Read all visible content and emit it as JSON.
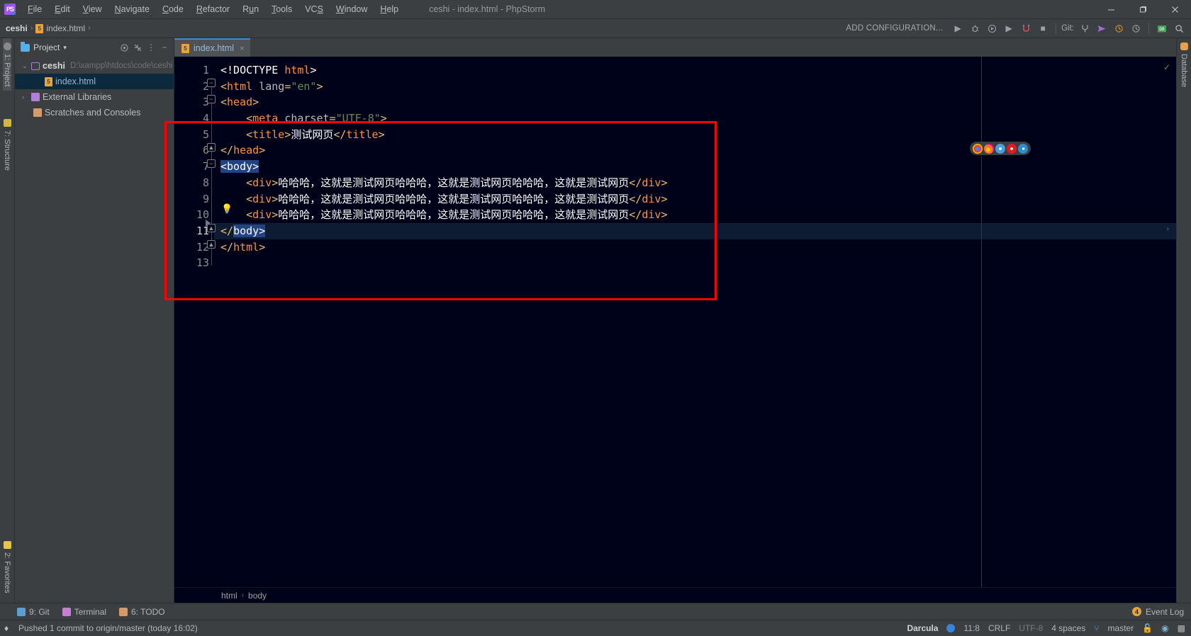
{
  "window": {
    "title": "ceshi - index.html - PhpStorm",
    "logo_icon": "phpstorm-logo-icon",
    "minimize_icon": "minimize-icon",
    "maximize_icon": "maximize-icon",
    "close_icon": "close-icon"
  },
  "menubar": [
    {
      "label": "File",
      "mnemonic": "F"
    },
    {
      "label": "Edit",
      "mnemonic": "E"
    },
    {
      "label": "View",
      "mnemonic": "V"
    },
    {
      "label": "Navigate",
      "mnemonic": "N"
    },
    {
      "label": "Code",
      "mnemonic": "C"
    },
    {
      "label": "Refactor",
      "mnemonic": "R"
    },
    {
      "label": "Run",
      "mnemonic": "u"
    },
    {
      "label": "Tools",
      "mnemonic": "T"
    },
    {
      "label": "VCS",
      "mnemonic": "S"
    },
    {
      "label": "Window",
      "mnemonic": "W"
    },
    {
      "label": "Help",
      "mnemonic": "H"
    }
  ],
  "navbar": {
    "crumbs": [
      {
        "label": "ceshi",
        "icon": ""
      },
      {
        "label": "index.html",
        "icon": "html5-file-icon"
      }
    ],
    "separator": "›",
    "add_configuration": "ADD CONFIGURATION...",
    "git_label": "Git:",
    "actions": [
      {
        "name": "run-button",
        "glyph": "▶"
      },
      {
        "name": "debug-button",
        "glyph": "☸"
      },
      {
        "name": "run-with-coverage-button",
        "glyph": "◉"
      },
      {
        "name": "run-profiler-button",
        "glyph": "▶"
      },
      {
        "name": "stop-debug-button",
        "glyph": "↓"
      },
      {
        "name": "stop-button",
        "glyph": "■"
      }
    ],
    "git_actions": [
      {
        "name": "update-project-icon",
        "glyph": "⑂"
      },
      {
        "name": "commit-icon",
        "glyph": "➤"
      },
      {
        "name": "rollback-icon",
        "glyph": "↺"
      },
      {
        "name": "history-icon",
        "glyph": "↻"
      }
    ],
    "right_actions": [
      {
        "name": "database-icon",
        "glyph": "▤"
      },
      {
        "name": "search-everywhere-icon",
        "glyph": "⚲"
      }
    ]
  },
  "left_strip": {
    "top": [
      {
        "label": "1: Project",
        "active": true,
        "icon_color": "#9a9a9a"
      },
      {
        "label": "7: Structure",
        "active": false,
        "icon_color": "#d6b63c"
      }
    ],
    "bottom": [
      {
        "label": "2: Favorites",
        "active": false,
        "icon_color": "#e8c547"
      }
    ]
  },
  "right_strip": {
    "items": [
      {
        "label": "Database",
        "icon_color": "#e8a33d"
      }
    ]
  },
  "project_panel": {
    "title": "Project",
    "title_dropdown": "▾",
    "actions": [
      {
        "name": "locate-file-icon",
        "glyph": "◎"
      },
      {
        "name": "collapse-all-icon",
        "glyph": "↖"
      },
      {
        "name": "options-icon",
        "glyph": "⋮"
      },
      {
        "name": "hide-icon",
        "glyph": "−"
      }
    ],
    "tree": [
      {
        "label": "ceshi",
        "path": "D:\\xampp\\htdocs\\code\\ceshi",
        "arrow": "⌄",
        "icon": "project-folder-icon",
        "indent": 0,
        "selected": false
      },
      {
        "label": "index.html",
        "path": "",
        "arrow": "",
        "icon": "html5-file-icon",
        "indent": 1,
        "selected": true
      },
      {
        "label": "External Libraries",
        "path": "",
        "arrow": "›",
        "icon": "library-icon",
        "indent": 0,
        "selected": false
      },
      {
        "label": "Scratches and Consoles",
        "path": "",
        "arrow": "",
        "icon": "scratches-icon",
        "indent": 0,
        "selected": false
      }
    ]
  },
  "editor": {
    "tab": {
      "label": "index.html",
      "icon": "html5-file-icon",
      "close": "×"
    },
    "line_numbers": [
      "1",
      "2",
      "3",
      "4",
      "5",
      "6",
      "7",
      "8",
      "9",
      "10",
      "11",
      "12",
      "13"
    ],
    "current_line": 11,
    "breadcrumbs": [
      "html",
      "body"
    ],
    "breadcrumb_sep": "›",
    "lines": [
      {
        "n": 1,
        "segments": [
          {
            "t": "<!DOCTYPE ",
            "c": "doctype"
          },
          {
            "t": "html",
            "c": "tagn"
          },
          {
            "t": ">",
            "c": "doctype"
          }
        ]
      },
      {
        "n": 2,
        "segments": [
          {
            "t": "<",
            "c": "tag"
          },
          {
            "t": "html",
            "c": "tagn"
          },
          {
            "t": " ",
            "c": "attr"
          },
          {
            "t": "lang",
            "c": "attr"
          },
          {
            "t": "=",
            "c": "tag"
          },
          {
            "t": "\"en\"",
            "c": "attrv"
          },
          {
            "t": ">",
            "c": "tag"
          }
        ]
      },
      {
        "n": 3,
        "segments": [
          {
            "t": "<",
            "c": "tag"
          },
          {
            "t": "head",
            "c": "tagn"
          },
          {
            "t": ">",
            "c": "tag"
          }
        ]
      },
      {
        "n": 4,
        "segments": [
          {
            "t": "    <",
            "c": "tag"
          },
          {
            "t": "meta",
            "c": "tagn"
          },
          {
            "t": " ",
            "c": "attr"
          },
          {
            "t": "charset",
            "c": "attr"
          },
          {
            "t": "=",
            "c": "tag"
          },
          {
            "t": "\"UTF-8\"",
            "c": "attrv"
          },
          {
            "t": ">",
            "c": "tag"
          }
        ]
      },
      {
        "n": 5,
        "segments": [
          {
            "t": "    <",
            "c": "tag"
          },
          {
            "t": "title",
            "c": "tagn"
          },
          {
            "t": ">",
            "c": "tag"
          },
          {
            "t": "测试网页",
            "c": "txt"
          },
          {
            "t": "</",
            "c": "tag"
          },
          {
            "t": "title",
            "c": "tagn"
          },
          {
            "t": ">",
            "c": "tag"
          }
        ]
      },
      {
        "n": 6,
        "segments": [
          {
            "t": "</",
            "c": "tag"
          },
          {
            "t": "head",
            "c": "tagn"
          },
          {
            "t": ">",
            "c": "tag"
          }
        ]
      },
      {
        "n": 7,
        "segments": [
          {
            "t": "<",
            "c": "sel"
          },
          {
            "t": "body",
            "c": "sel"
          },
          {
            "t": ">",
            "c": "sel"
          }
        ]
      },
      {
        "n": 8,
        "segments": [
          {
            "t": "    <",
            "c": "tag"
          },
          {
            "t": "div",
            "c": "tagn"
          },
          {
            "t": ">",
            "c": "tag"
          },
          {
            "t": "哈哈哈，这就是测试网页哈哈哈，这就是测试网页哈哈哈，这就是测试网页",
            "c": "txt"
          },
          {
            "t": "</",
            "c": "tag"
          },
          {
            "t": "div",
            "c": "tagn"
          },
          {
            "t": ">",
            "c": "tag"
          }
        ]
      },
      {
        "n": 9,
        "segments": [
          {
            "t": "    <",
            "c": "tag"
          },
          {
            "t": "div",
            "c": "tagn"
          },
          {
            "t": ">",
            "c": "tag"
          },
          {
            "t": "哈哈哈，这就是测试网页哈哈哈，这就是测试网页哈哈哈，这就是测试网页",
            "c": "txt"
          },
          {
            "t": "</",
            "c": "tag"
          },
          {
            "t": "div",
            "c": "tagn"
          },
          {
            "t": ">",
            "c": "tag"
          }
        ]
      },
      {
        "n": 10,
        "segments": [
          {
            "t": "    <",
            "c": "tag"
          },
          {
            "t": "div",
            "c": "tagn"
          },
          {
            "t": ">",
            "c": "tag"
          },
          {
            "t": "哈哈哈，这就是测试网页哈哈哈，这就是测试网页哈哈哈，这就是测试网页",
            "c": "txt"
          },
          {
            "t": "</",
            "c": "tag"
          },
          {
            "t": "div",
            "c": "tagn"
          },
          {
            "t": ">",
            "c": "tag"
          }
        ]
      },
      {
        "n": 11,
        "segments": [
          {
            "t": "</",
            "c": "tag"
          },
          {
            "t": "body",
            "c": "sel"
          },
          {
            "t": ">",
            "c": "sel"
          }
        ]
      },
      {
        "n": 12,
        "segments": [
          {
            "t": "</",
            "c": "tag"
          },
          {
            "t": "html",
            "c": "tagn"
          },
          {
            "t": ">",
            "c": "tag"
          }
        ]
      },
      {
        "n": 13,
        "segments": []
      }
    ],
    "intention_bulb": "💡",
    "browser_popup": [
      {
        "name": "chrome-icon",
        "color": "#4285f4"
      },
      {
        "name": "firefox-icon",
        "color": "#e66000"
      },
      {
        "name": "safari-icon",
        "color": "#4a9ede"
      },
      {
        "name": "opera-icon",
        "color": "#e01b24"
      },
      {
        "name": "edge-icon",
        "color": "#2d8ecf"
      }
    ],
    "inspection_status": "✓"
  },
  "annotation": {
    "shape": "rectangle",
    "color": "#ff0000"
  },
  "bottom_toolwindows": [
    {
      "label": "9: Git",
      "mnemonic": "9",
      "icon": "git-icon",
      "color": "#5a9fd4"
    },
    {
      "label": "Terminal",
      "mnemonic": "",
      "icon": "terminal-icon",
      "color": "#c47fd0"
    },
    {
      "label": "6: TODO",
      "mnemonic": "6",
      "icon": "todo-icon",
      "color": "#d79a6b"
    }
  ],
  "event_log": {
    "label": "Event Log",
    "count": "4"
  },
  "statusbar": {
    "message": "Pushed 1 commit to origin/master (today 16:02)",
    "message_icon": "layers-icon",
    "theme": "Darcula",
    "caret_position": "11:8",
    "line_separator": "CRLF",
    "encoding": "UTF-8",
    "indent": "4 spaces",
    "branch": "master",
    "branch_icon": "git-branch-icon",
    "lock_icon": "read-only-lock-icon",
    "inspections_icon": "inspections-icon",
    "db_icon": "database-status-icon"
  }
}
